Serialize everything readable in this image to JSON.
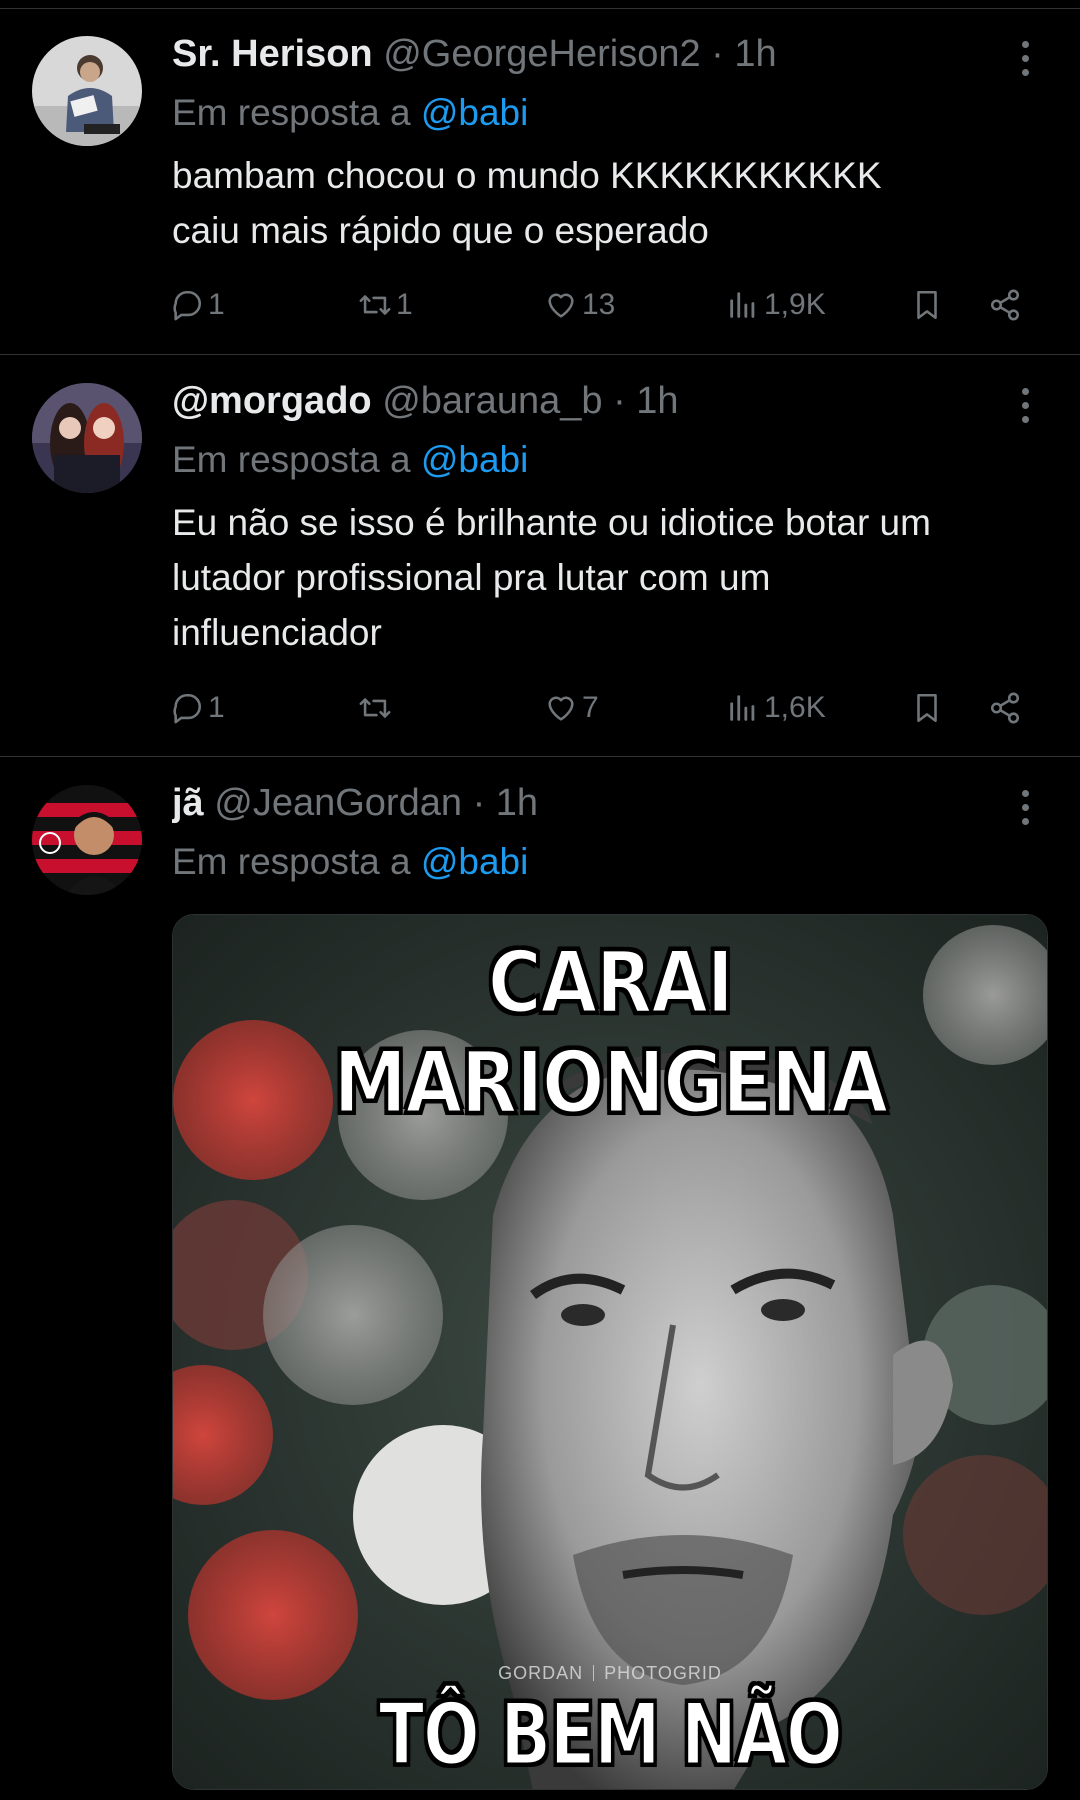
{
  "tweets": [
    {
      "name": "Sr. Herison",
      "handle": "@GeorgeHerison2",
      "dot": "·",
      "time": "1h",
      "reply_prefix": "Em resposta a",
      "reply_to": "@babi",
      "text_lines": [
        "bambam chocou o mundo KKKKKKKKKKK",
        "caiu mais rápido que o esperado"
      ],
      "replies": "1",
      "retweets": "1",
      "likes": "13",
      "views": "1,9K"
    },
    {
      "name": "@morgado",
      "handle": "@barauna_b",
      "dot": "·",
      "time": "1h",
      "reply_prefix": "Em resposta a",
      "reply_to": "@babi",
      "text_lines": [
        "Eu não se isso é brilhante ou idiotice botar um",
        "lutador profissional pra lutar com um",
        "influenciador"
      ],
      "replies": "1",
      "retweets": "",
      "likes": "7",
      "views": "1,6K"
    },
    {
      "name": "jã",
      "handle": "@JeanGordan",
      "dot": "·",
      "time": "1h",
      "reply_prefix": "Em resposta a",
      "reply_to": "@babi",
      "media": {
        "caption_top": "CARAI MARIONGENA",
        "caption_bottom": "TÔ BEM NÃO",
        "watermark_left": "GORDAN",
        "watermark_right": "PHOTOGRID"
      }
    }
  ],
  "icons": {
    "reply": "reply-icon",
    "retweet": "retweet-icon",
    "like": "heart-icon",
    "views": "views-icon",
    "bookmark": "bookmark-icon",
    "share": "share-icon",
    "more": "more-icon"
  },
  "colors": {
    "background": "#000000",
    "text": "#e7e9ea",
    "secondary": "#71767b",
    "link": "#1d9bf0",
    "divider": "#2f3336"
  }
}
